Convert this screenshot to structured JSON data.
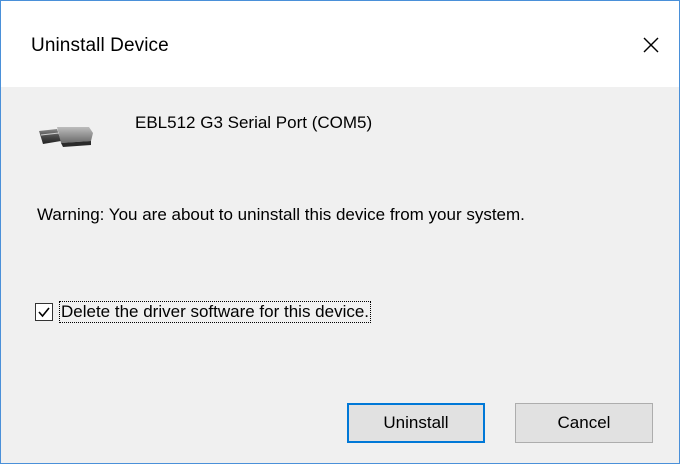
{
  "dialog": {
    "title": "Uninstall Device",
    "close_icon": "close-icon",
    "device_icon": "serial-port-icon",
    "device_name": "EBL512 G3 Serial Port (COM5)",
    "warning": "Warning: You are about to uninstall this device from your system.",
    "checkbox": {
      "label": "Delete the driver software for this device.",
      "checked": true
    },
    "buttons": {
      "uninstall_label": "Uninstall",
      "cancel_label": "Cancel"
    }
  },
  "colors": {
    "accent": "#0078d7",
    "window_border": "#4a90d9",
    "body_background": "#f0f0f0",
    "titlebar_background": "#ffffff",
    "button_background": "#e1e1e1"
  }
}
